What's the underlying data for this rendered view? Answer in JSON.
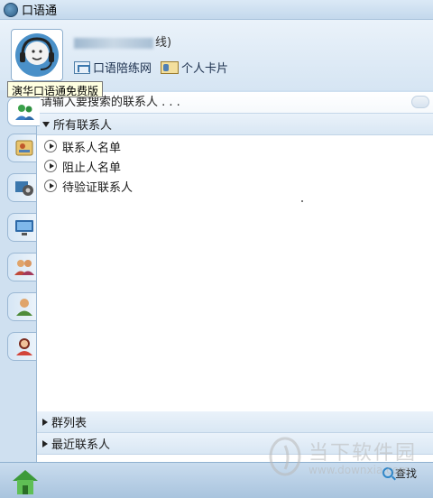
{
  "window": {
    "title": "口语通"
  },
  "profile": {
    "status_suffix": "线)",
    "links": [
      {
        "label": "口语陪练网"
      },
      {
        "label": "个人卡片"
      }
    ]
  },
  "tooltip": {
    "text": "演华口语通免费版"
  },
  "search": {
    "placeholder": "请输入要搜索的联系人 . . ."
  },
  "groups": {
    "all_contacts": {
      "label": "所有联系人",
      "items": [
        {
          "label": "联系人名单"
        },
        {
          "label": "阻止人名单"
        },
        {
          "label": "待验证联系人"
        }
      ]
    },
    "group_list": {
      "label": "群列表"
    },
    "recent": {
      "label": "最近联系人"
    }
  },
  "bottom": {
    "find_label": "查找"
  },
  "watermark": {
    "brand": "当下软件园",
    "url": "www.downxia.com"
  },
  "colors": {
    "accent_blue": "#2f86c8",
    "header_bg": "#d9e7f4",
    "tab_border": "#9bb8d4"
  }
}
